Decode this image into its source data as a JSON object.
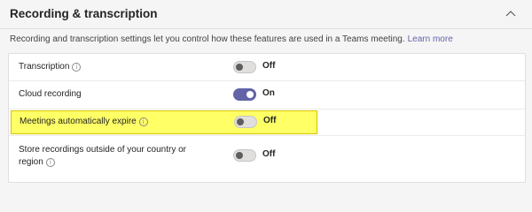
{
  "section": {
    "title": "Recording & transcription",
    "description": "Recording and transcription settings let you control how these features are used in a Teams meeting.",
    "learn_more": "Learn more",
    "collapse_icon": "chevron-up-icon"
  },
  "settings": [
    {
      "label": "Transcription",
      "has_info": true,
      "state": "Off",
      "on": false
    },
    {
      "label": "Cloud recording",
      "has_info": false,
      "state": "On",
      "on": true
    },
    {
      "label": "Meetings automatically expire",
      "has_info": true,
      "state": "Off",
      "on": false,
      "highlighted": true
    },
    {
      "label_line1": "Store recordings outside of your country or",
      "label_line2": "region",
      "has_info": true,
      "state": "Off",
      "on": false
    }
  ],
  "colors": {
    "accent": "#6264a7",
    "highlight": "#ffff66"
  }
}
